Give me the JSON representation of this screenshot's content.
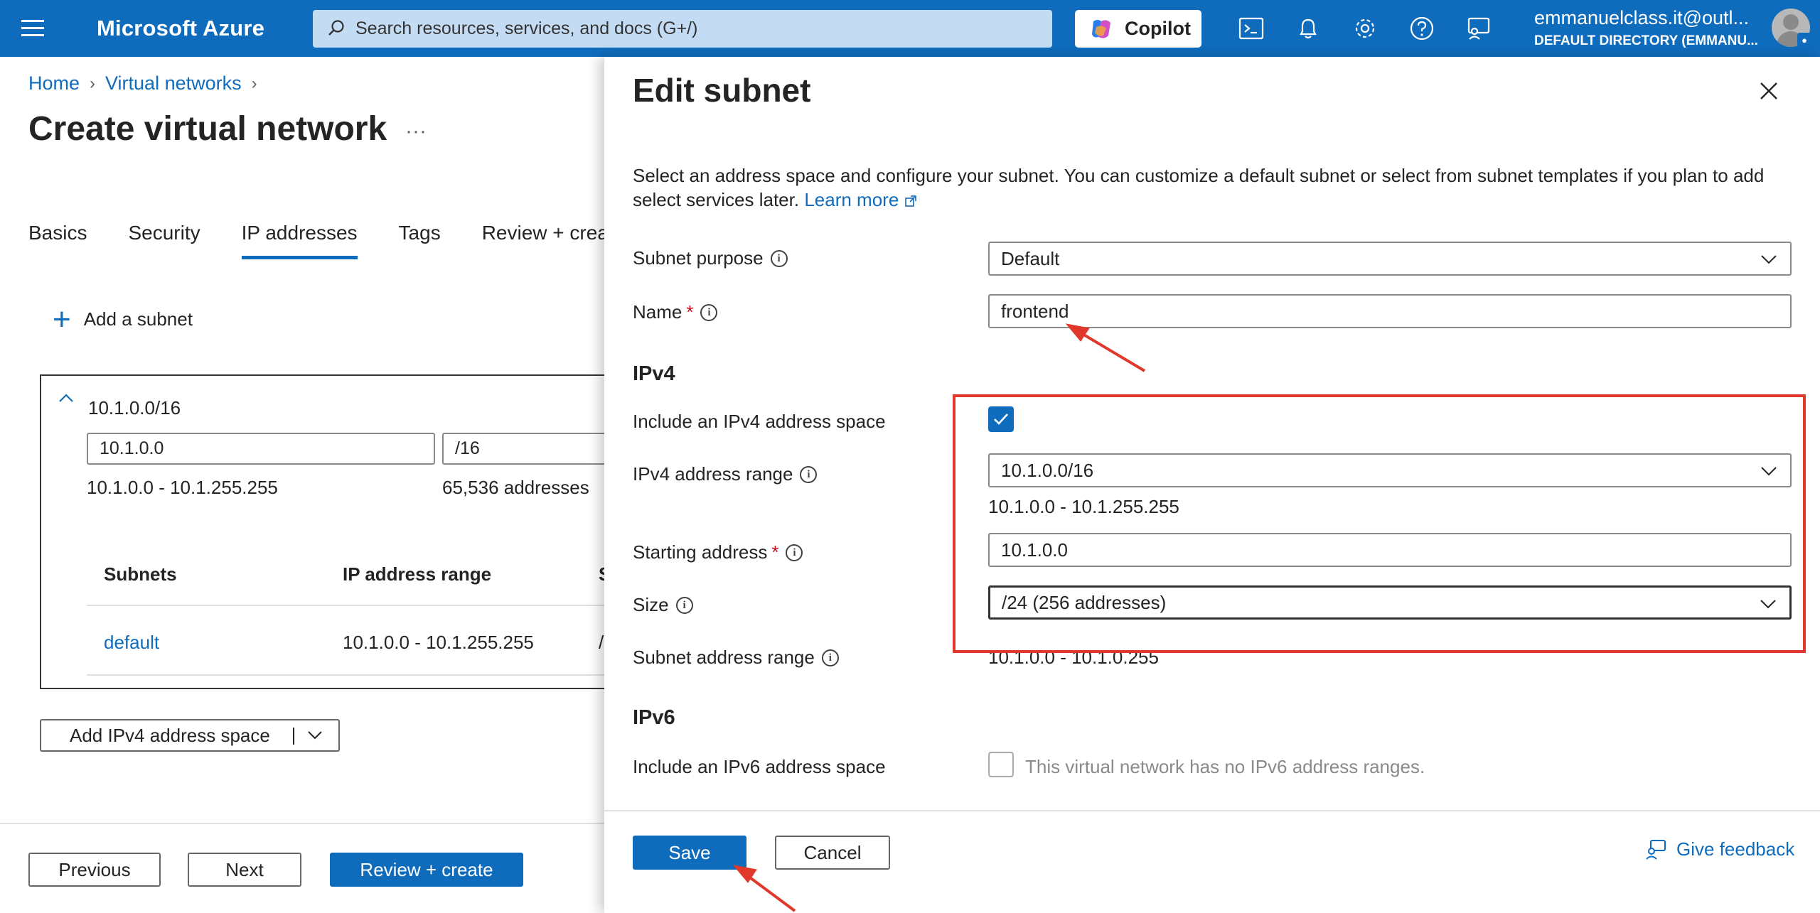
{
  "topbar": {
    "brand": "Microsoft Azure",
    "search_placeholder": "Search resources, services, and docs (G+/)",
    "copilot_label": "Copilot",
    "account_email": "emmanuelclass.it@outl...",
    "account_directory": "DEFAULT DIRECTORY (EMMANU..."
  },
  "breadcrumb": [
    "Home",
    "Virtual networks"
  ],
  "page_title": "Create virtual network",
  "tabs": [
    "Basics",
    "Security",
    "IP addresses",
    "Tags",
    "Review + create"
  ],
  "active_tab": "IP addresses",
  "add_subnet_label": "Add a subnet",
  "address_space": {
    "label": "10.1.0.0/16",
    "start_value": "10.1.0.0",
    "size_value": "/16",
    "range_text": "10.1.0.0 - 10.1.255.255",
    "count_text": "65,536 addresses",
    "table_headers": [
      "Subnets",
      "IP address range",
      "S"
    ],
    "rows": [
      {
        "name": "default",
        "range": "10.1.0.0 - 10.1.255.255",
        "size": "/"
      }
    ]
  },
  "add_ipv4_label": "Add IPv4 address space",
  "footer": {
    "previous": "Previous",
    "next": "Next",
    "review": "Review + create"
  },
  "panel": {
    "title": "Edit subnet",
    "description": "Select an address space and configure your subnet. You can customize a default subnet or select from subnet templates if you plan to add select services later.",
    "learn_more": "Learn more",
    "subnet_purpose_label": "Subnet purpose",
    "subnet_purpose_value": "Default",
    "name_label": "Name",
    "required_mark": "*",
    "name_value": "frontend",
    "ipv4_heading": "IPv4",
    "include_ipv4_label": "Include an IPv4 address space",
    "include_ipv4_checked": true,
    "ipv4_range_label": "IPv4 address range",
    "ipv4_range_value": "10.1.0.0/16",
    "ipv4_range_hint": "10.1.0.0 - 10.1.255.255",
    "starting_address_label": "Starting address",
    "starting_address_value": "10.1.0.0",
    "size_label": "Size",
    "size_value": "/24 (256 addresses)",
    "subnet_range_label": "Subnet address range",
    "subnet_range_value": "10.1.0.0 - 10.1.0.255",
    "ipv6_heading": "IPv6",
    "include_ipv6_label": "Include an IPv6 address space",
    "include_ipv6_checked": false,
    "ipv6_note": "This virtual network has no IPv6 address ranges.",
    "save": "Save",
    "cancel": "Cancel",
    "feedback": "Give feedback",
    "info_glyph": "i"
  },
  "colors": {
    "azure_blue": "#0f6cbd",
    "annotation_red": "#e0392b"
  }
}
